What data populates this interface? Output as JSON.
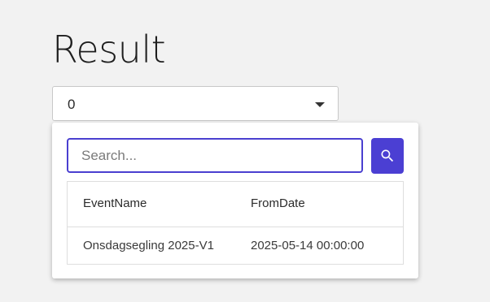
{
  "page": {
    "title": "Result"
  },
  "select": {
    "value": "0"
  },
  "dropdown": {
    "search": {
      "placeholder": "Search...",
      "value": ""
    },
    "search_button": {
      "icon": "search-icon"
    },
    "table": {
      "columns": [
        "EventName",
        "FromDate"
      ],
      "rows": [
        [
          "Onsdagsegling 2025-V1",
          "2025-05-14 00:00:00"
        ]
      ]
    }
  },
  "colors": {
    "accent": "#4a3fd0",
    "button_bg": "#4b3fd3",
    "page_bg": "#f2f2f2"
  }
}
